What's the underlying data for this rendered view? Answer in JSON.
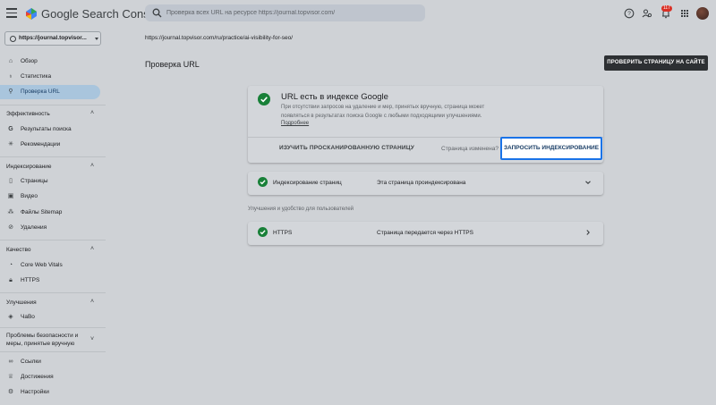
{
  "app": {
    "title": "Google Search Console"
  },
  "search": {
    "placeholder": "Проверка всех URL на ресурсе https://journal.topvisor.com/"
  },
  "topbar": {
    "notifications_count": "117"
  },
  "property": {
    "label": "https://journal.topvisor..."
  },
  "sidebar": {
    "items": [
      {
        "label": "Обзор",
        "icon": "home-icon"
      },
      {
        "label": "Статистика",
        "icon": "stats-icon"
      },
      {
        "label": "Проверка URL",
        "icon": "search-icon",
        "active": true
      }
    ],
    "sections": [
      {
        "title": "Эффективность",
        "items": [
          {
            "label": "Результаты поиска",
            "icon": "google-g-icon"
          },
          {
            "label": "Рекомендации",
            "icon": "sparkle-icon"
          }
        ]
      },
      {
        "title": "Индексирование",
        "items": [
          {
            "label": "Страницы",
            "icon": "pages-icon"
          },
          {
            "label": "Видео",
            "icon": "video-icon"
          },
          {
            "label": "Файлы Sitemap",
            "icon": "sitemap-icon"
          },
          {
            "label": "Удаления",
            "icon": "removals-icon"
          }
        ]
      },
      {
        "title": "Качество",
        "items": [
          {
            "label": "Core Web Vitals",
            "icon": "gauge-icon"
          },
          {
            "label": "HTTPS",
            "icon": "lock-icon"
          }
        ]
      },
      {
        "title": "Улучшения",
        "items": [
          {
            "label": "ЧаВо",
            "icon": "layers-icon"
          }
        ]
      },
      {
        "title": "Проблемы безопасности и меры, принятые вручную",
        "items": []
      }
    ],
    "bottom": [
      {
        "label": "Ссылки",
        "icon": "link-icon"
      },
      {
        "label": "Достижения",
        "icon": "trophy-icon"
      },
      {
        "label": "Настройки",
        "icon": "gear-icon"
      }
    ]
  },
  "main": {
    "url": "https://journal.topvisor.com/ru/practice/ai-visibility-for-seo/",
    "page_title": "Проверка URL",
    "inspect_button": "ПРОВЕРИТЬ СТРАНИЦУ НА САЙТЕ",
    "status_card": {
      "title": "URL есть в индексе Google",
      "description": "При отсутствии запросов на удаление и мер, принятых вручную, страница может появляться в результатах поиска Google с любыми подходящими улучшениями.",
      "more_link": "Подробнее",
      "study_button": "ИЗУЧИТЬ ПРОСКАНИРОВАННУЮ СТРАНИЦУ",
      "changed_question": "Страница изменена?",
      "request_button": "ЗАПРОСИТЬ ИНДЕКСИРОВАНИЕ"
    },
    "indexing_row": {
      "label": "Индексирование страниц",
      "value": "Эта страница проиндексирована"
    },
    "enhancements_title": "Улучшения и удобство для пользователей",
    "https_row": {
      "label": "HTTPS",
      "value": "Страница передается через HTTPS"
    }
  },
  "colors": {
    "accent": "#1a73e8",
    "success": "#188038",
    "active_nav": "#a9c5dd",
    "badge": "#d93025"
  }
}
